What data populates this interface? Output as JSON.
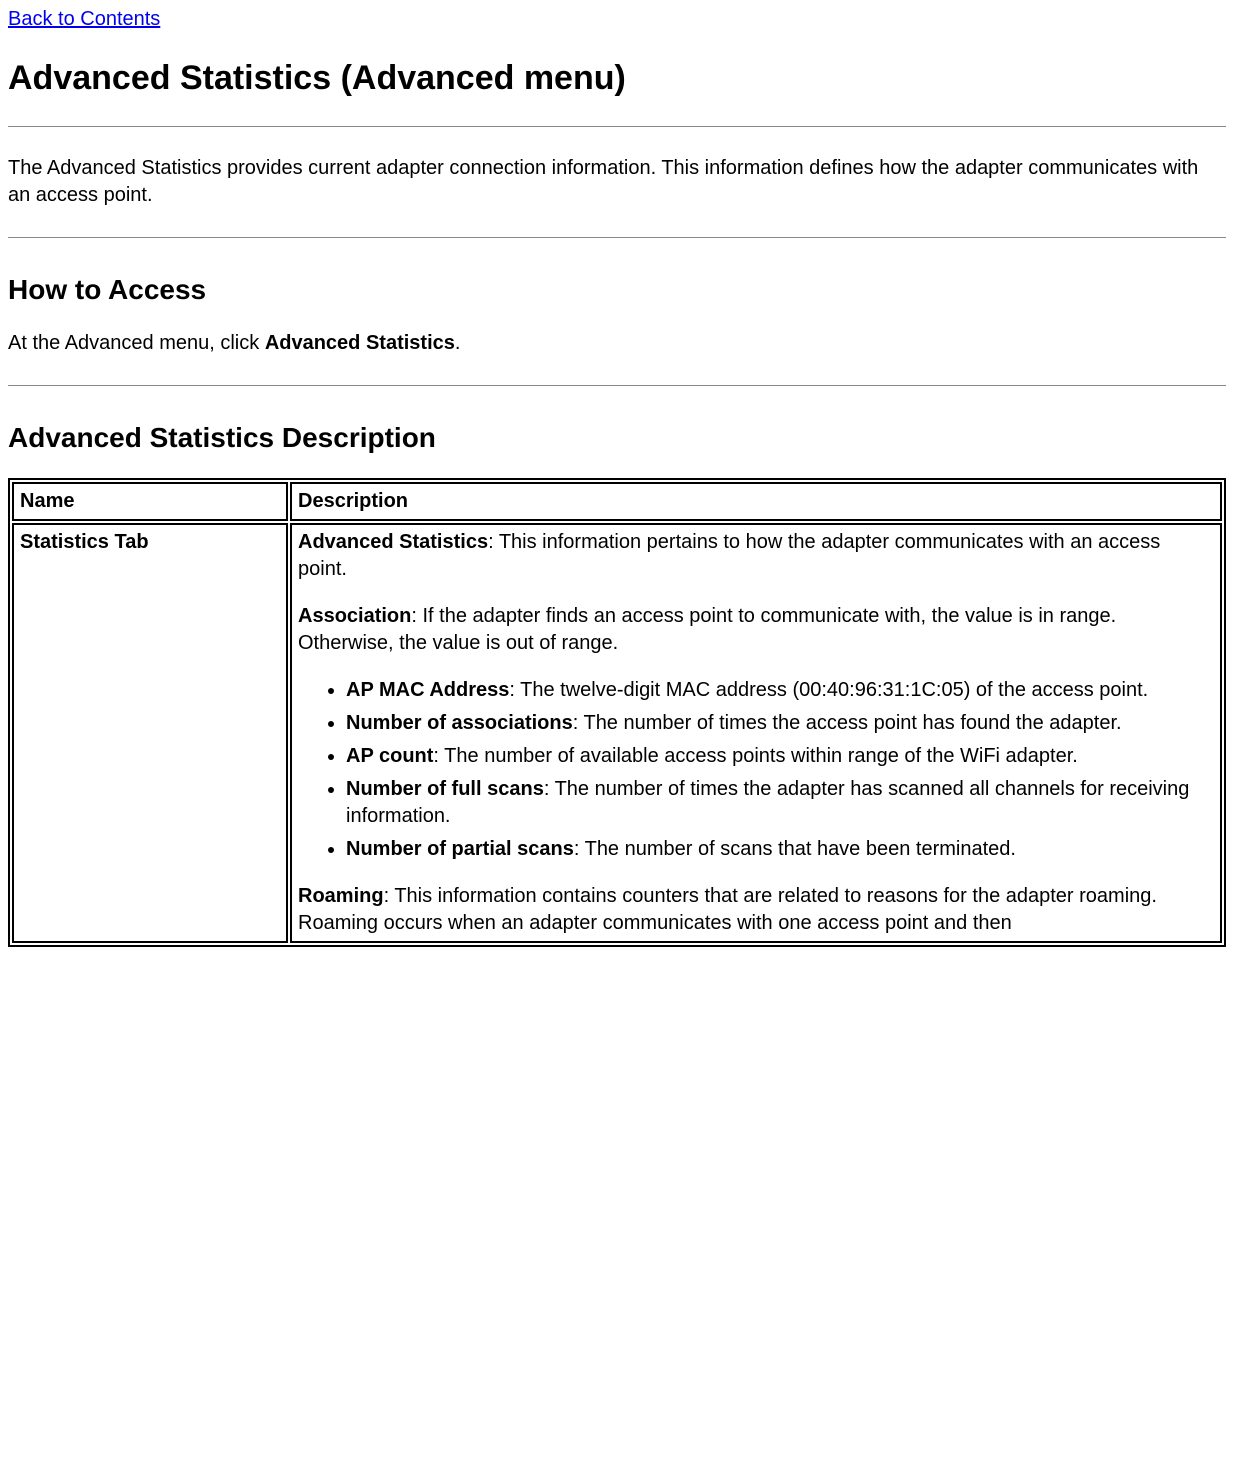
{
  "back_link": "Back to Contents",
  "title": "Advanced Statistics (Advanced menu)",
  "intro": "The Advanced Statistics provides current adapter connection information. This information defines how the adapter communicates with an access point.",
  "how_to_access_heading": "How to Access",
  "how_to_access_prefix": "At the Advanced menu, click ",
  "how_to_access_bold": "Advanced Statistics",
  "how_to_access_suffix": ".",
  "desc_heading": "Advanced Statistics Description",
  "table": {
    "head_name": "Name",
    "head_desc": "Description",
    "row_name": "Statistics Tab",
    "adv_stats_label": "Advanced Statistics",
    "adv_stats_text": ": This information pertains to how the adapter communicates with an access point.",
    "assoc_label": "Association",
    "assoc_text": ": If the adapter finds an access point to communicate with, the value is in range. Otherwise, the value is out of range.",
    "bullets": [
      {
        "label": "AP MAC Address",
        "text": ": The twelve-digit MAC address (00:40:96:31:1C:05) of the access point."
      },
      {
        "label": "Number of associations",
        "text": ": The number of times the access point has found the adapter."
      },
      {
        "label": "AP count",
        "text": ": The number of available access points within range of the WiFi adapter."
      },
      {
        "label": "Number of full scans",
        "text": ": The number of times the adapter has scanned all channels for receiving information."
      },
      {
        "label": "Number of partial scans",
        "text": ": The number of scans that have been terminated."
      }
    ],
    "roaming_label": "Roaming",
    "roaming_text": ": This information contains counters that are related to reasons for the adapter roaming. Roaming occurs when an adapter communicates with one access point and then"
  }
}
